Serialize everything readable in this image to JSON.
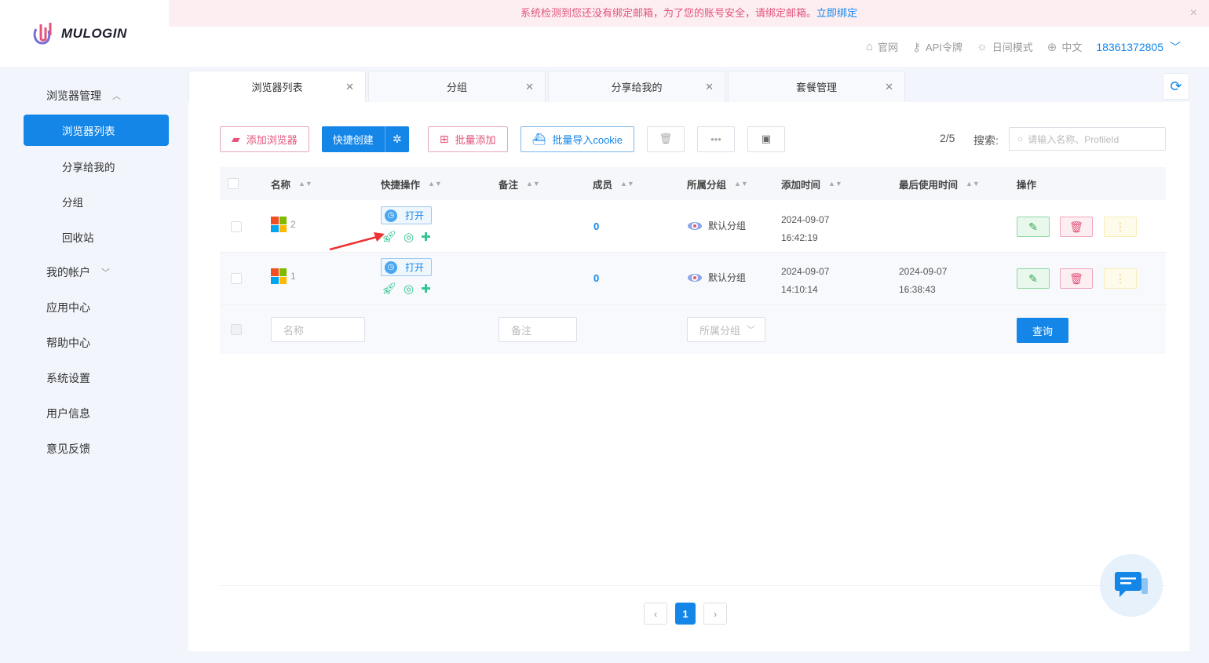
{
  "brand": {
    "name": "MULOGIN"
  },
  "notice": {
    "text": "系统检测到您还没有绑定邮箱，为了您的账号安全，请绑定邮箱。",
    "link": "立即绑定",
    "close": "×"
  },
  "topbar": {
    "website": "官网",
    "api_token": "API令牌",
    "day_mode": "日间模式",
    "language": "中文",
    "user": "18361372805"
  },
  "sidebar": {
    "browser_mgmt": "浏览器管理",
    "browser_list": "浏览器列表",
    "shared_to_me": "分享给我的",
    "groups": "分组",
    "recycle_bin": "回收站",
    "my_account": "我的帐户",
    "app_center": "应用中心",
    "help_center": "帮助中心",
    "system_settings": "系统设置",
    "user_info": "用户信息",
    "feedback": "意见反馈"
  },
  "tabs": [
    {
      "label": "浏览器列表"
    },
    {
      "label": "分组"
    },
    {
      "label": "分享给我的"
    },
    {
      "label": "套餐管理"
    }
  ],
  "toolbar": {
    "add_browser": "添加浏览器",
    "quick_create": "快捷创建",
    "batch_add": "批量添加",
    "batch_import_cookie": "批量导入cookie",
    "more": "•••",
    "page_count": "2/5",
    "search_label": "搜索:",
    "search_placeholder": "请输入名称、ProfileId"
  },
  "table": {
    "headers": {
      "name": "名称",
      "quick_ops": "快捷操作",
      "remark": "备注",
      "members": "成员",
      "group": "所属分组",
      "added_time": "添加时间",
      "last_used": "最后使用时间",
      "actions": "操作"
    },
    "open_label": "打开",
    "rows": [
      {
        "name": "2",
        "members": "0",
        "group": "默认分组",
        "added_date": "2024-09-07",
        "added_time": "16:42:19",
        "last_date": "",
        "last_time": ""
      },
      {
        "name": "1",
        "members": "0",
        "group": "默认分组",
        "added_date": "2024-09-07",
        "added_time": "14:10:14",
        "last_date": "2024-09-07",
        "last_time": "16:38:43"
      }
    ],
    "filter": {
      "name_placeholder": "名称",
      "remark_placeholder": "备注",
      "group_placeholder": "所属分组",
      "query": "查询"
    }
  },
  "pagination": {
    "current": "1"
  },
  "colors": {
    "primary": "#1486e8",
    "pink": "#e2547b",
    "green": "#2ec38f"
  }
}
